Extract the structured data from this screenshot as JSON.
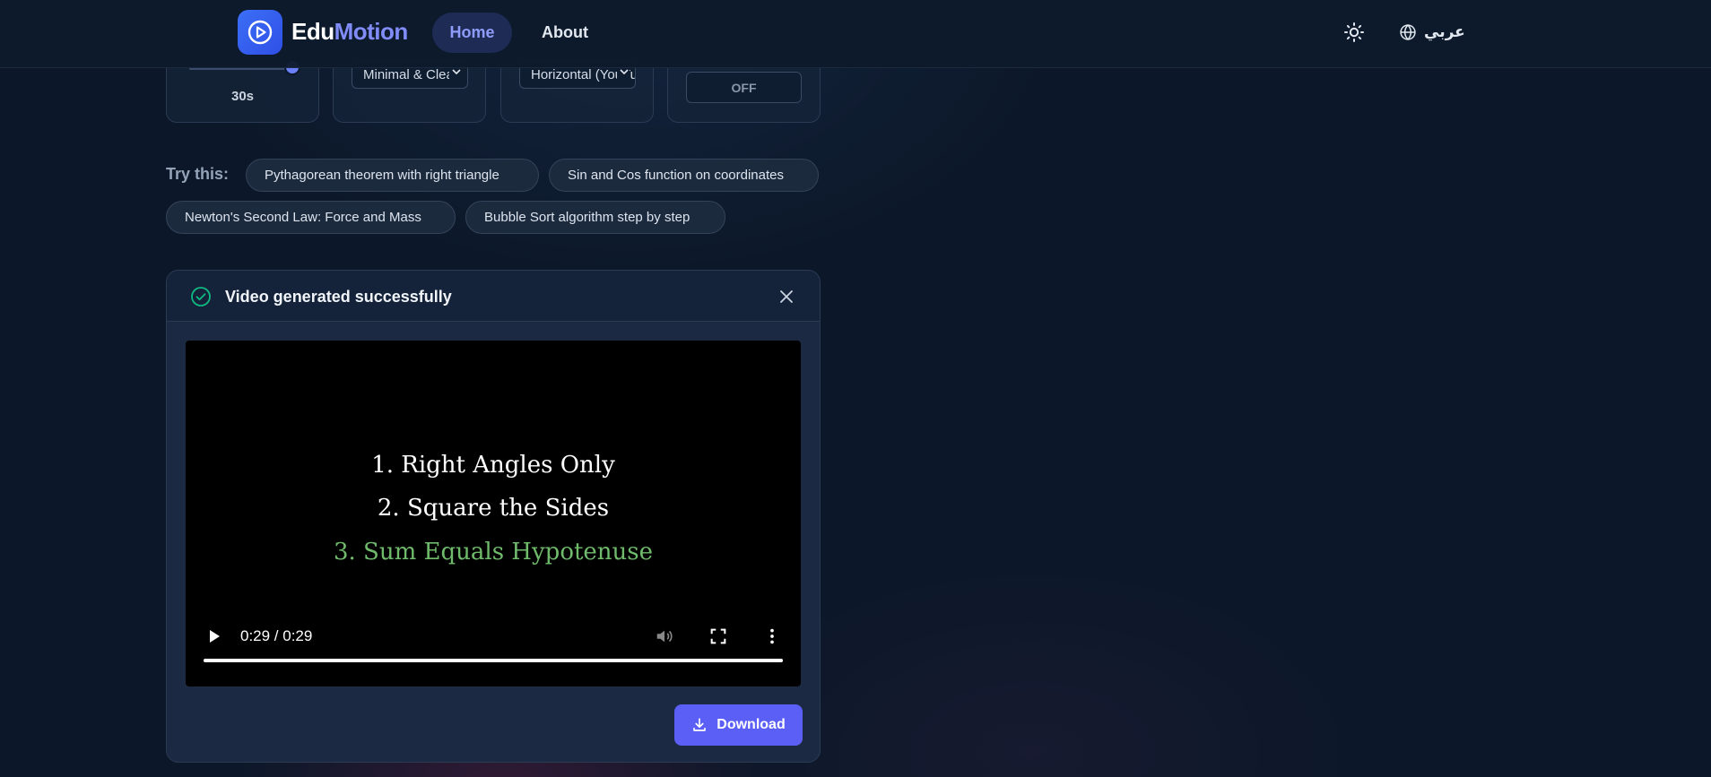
{
  "app": {
    "brand_part1": "Edu",
    "brand_part2": "Motion",
    "accent_color": "#818cf8"
  },
  "nav": {
    "home_label": "Home",
    "about_label": "About",
    "active": "Home",
    "language_label": "عربي",
    "theme_icon": "sun-icon",
    "language_icon": "globe-icon"
  },
  "settings": {
    "duration_value": "30s",
    "duration_fraction": 1.0,
    "style_value": "Minimal & Clean",
    "format_value": "Horizontal (YouTube)",
    "toggle_value": "OFF"
  },
  "suggestions": {
    "label": "Try this:",
    "chips": [
      "Pythagorean theorem with right triangle",
      "Sin and Cos function on coordinates",
      "Newton's Second Law: Force and Mass",
      "Bubble Sort algorithm step by step"
    ]
  },
  "result": {
    "title": "Video generated successfully",
    "status_color": "#10b981",
    "video": {
      "lines": [
        "1. Right Angles Only",
        "2. Square the Sides",
        "3. Sum Equals Hypotenuse"
      ],
      "highlight_color": "#6fbb6b",
      "time": "0:29 / 0:29",
      "progress_fraction": 1.0
    },
    "download_label": "Download",
    "download_color": "#5b5ff6"
  }
}
